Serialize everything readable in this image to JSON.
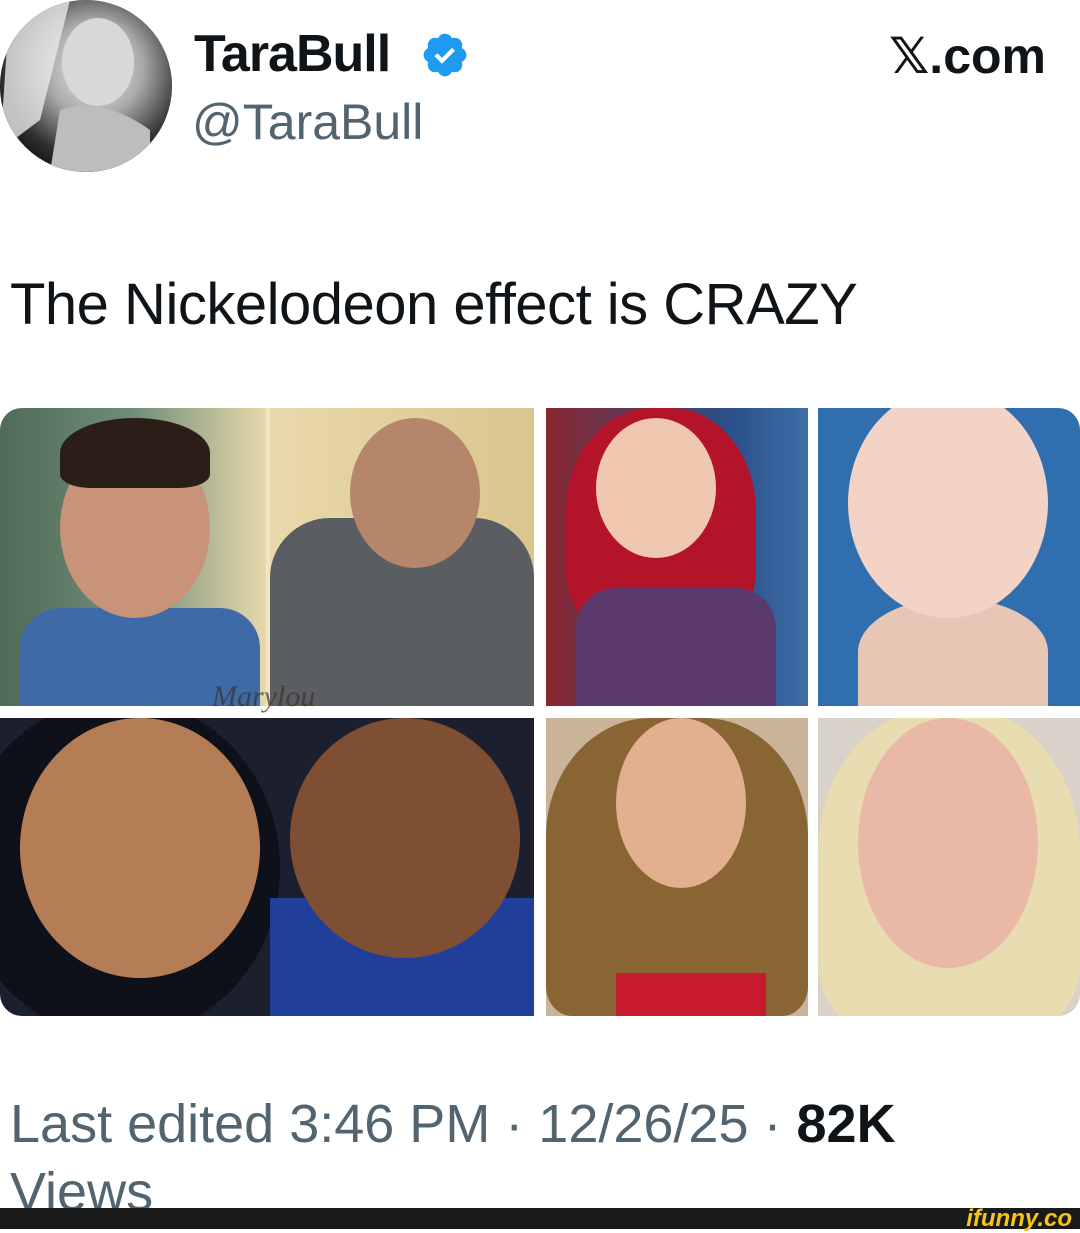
{
  "author": {
    "name": "TaraBull",
    "handle": "@TaraBull",
    "verified": true
  },
  "site": {
    "label": "𝕏.com"
  },
  "tweet": {
    "text": "The Nickelodeon effect is CRAZY"
  },
  "media": {
    "watermark": "Marylou"
  },
  "meta": {
    "edited_label": "Last edited 3:46 PM · 12/26/25 ·",
    "views_count": "82K",
    "views_label": "Views"
  },
  "footer": {
    "brand": "ifunny.co"
  },
  "colors": {
    "verified_badge": "#1d9bf0",
    "secondary_text": "#536471",
    "primary_text": "#0f1419",
    "brand_yellow": "#f5c518"
  },
  "icons": {
    "verified": "verified-badge-icon"
  }
}
